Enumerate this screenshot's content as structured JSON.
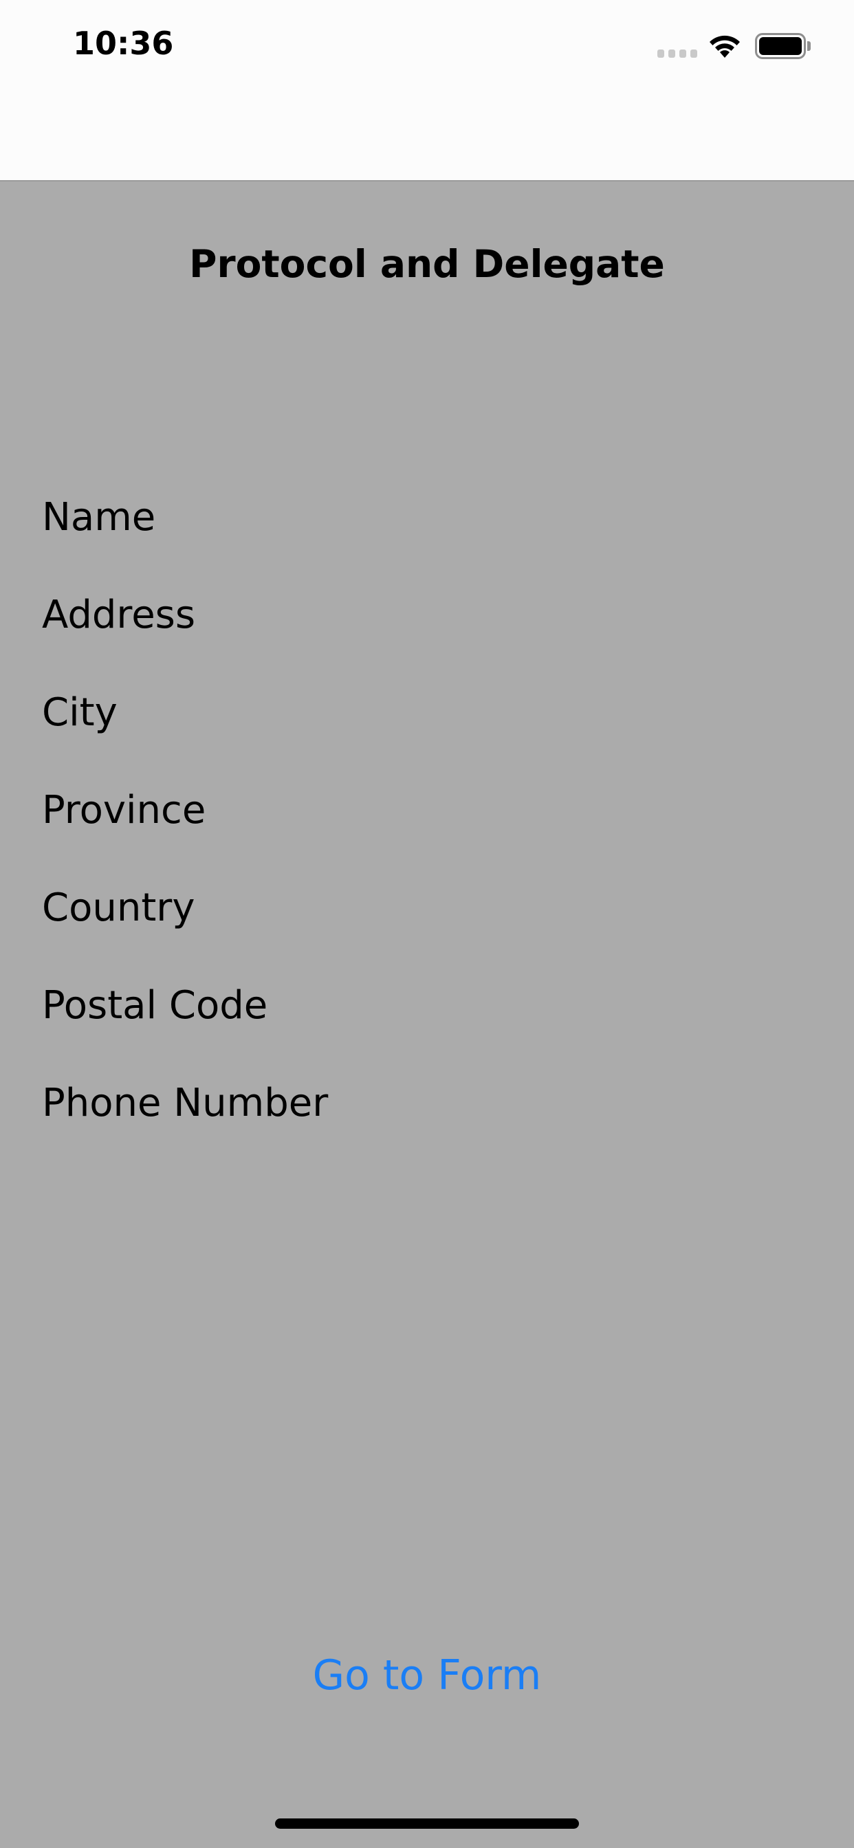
{
  "status_bar": {
    "time": "10:36",
    "signal_icon": "cellular-signal-icon",
    "wifi_icon": "wifi-icon",
    "battery_icon": "battery-icon",
    "battery_level": 1.0
  },
  "page": {
    "title": "Protocol and Delegate",
    "fields": [
      {
        "label": "Name"
      },
      {
        "label": "Address"
      },
      {
        "label": "City"
      },
      {
        "label": "Province"
      },
      {
        "label": "Country"
      },
      {
        "label": "Postal Code"
      },
      {
        "label": "Phone Number"
      }
    ],
    "go_to_form_label": "Go to Form"
  },
  "colors": {
    "background": "#ababab",
    "top_bar": "#fcfcfc",
    "link_blue": "#1a7ef5",
    "text": "#000000"
  }
}
